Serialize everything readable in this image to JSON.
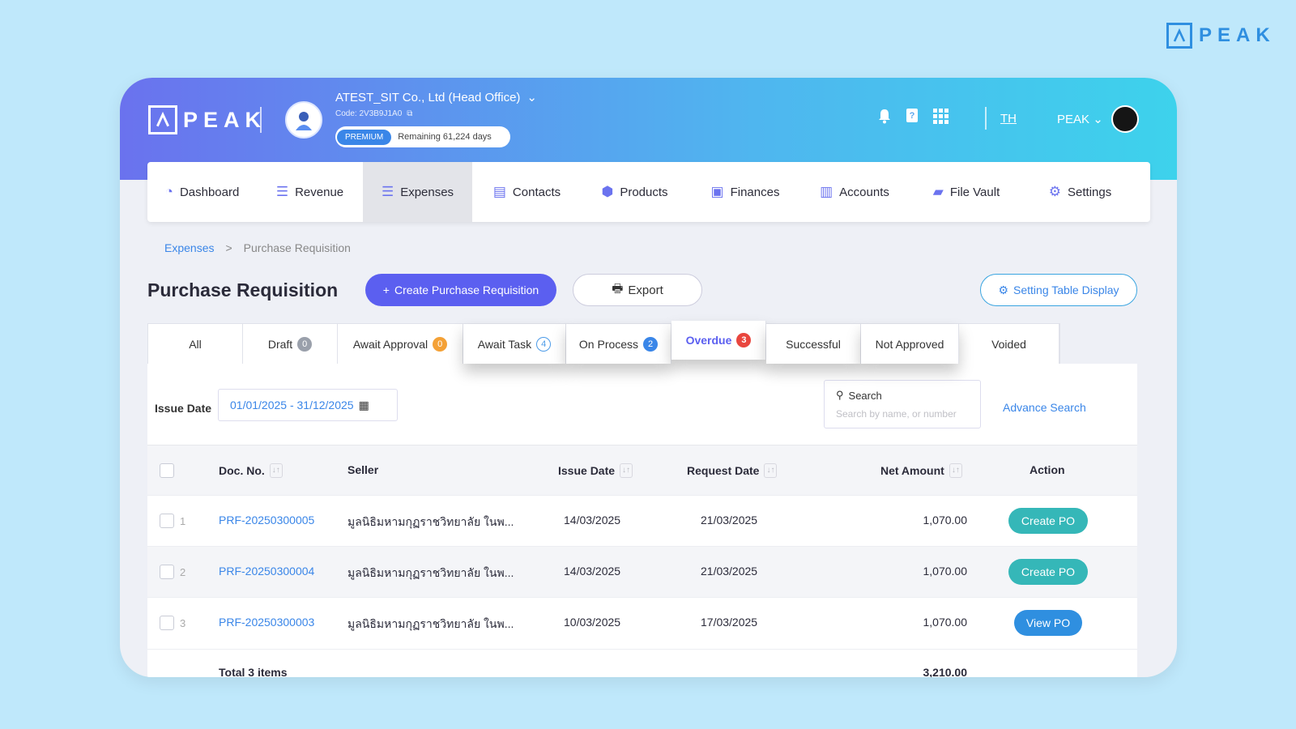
{
  "brand": {
    "logo_text": "PEAK"
  },
  "header": {
    "company_name": "ATEST_SIT Co., Ltd (Head Office)",
    "company_code": "Code: 2V3B9J1A0",
    "plan_badge": "PREMIUM",
    "plan_remaining": "Remaining 61,224 days",
    "language": "TH",
    "user_name": "PEAK",
    "icons": [
      "bell-icon",
      "help-book-icon",
      "apps-grid-icon"
    ]
  },
  "nav": {
    "items": [
      {
        "label": "Dashboard",
        "icon": "dashboard-icon"
      },
      {
        "label": "Revenue",
        "icon": "list-icon"
      },
      {
        "label": "Expenses",
        "icon": "list-icon",
        "active": true
      },
      {
        "label": "Contacts",
        "icon": "contacts-icon"
      },
      {
        "label": "Products",
        "icon": "box-icon"
      },
      {
        "label": "Finances",
        "icon": "money-icon"
      },
      {
        "label": "Accounts",
        "icon": "ledger-icon"
      },
      {
        "label": "File Vault",
        "icon": "folder-icon"
      },
      {
        "label": "Settings",
        "icon": "gear-icon"
      }
    ]
  },
  "breadcrumb": {
    "parent": "Expenses",
    "separator": ">",
    "current": "Purchase Requisition"
  },
  "page": {
    "title": "Purchase Requisition",
    "create_button": "Create Purchase Requisition",
    "export_button": "Export",
    "setting_button": "Setting Table Display"
  },
  "status_tabs": [
    {
      "label": "All",
      "count": null
    },
    {
      "label": "Draft",
      "count": "0"
    },
    {
      "label": "Await Approval",
      "count": "0"
    },
    {
      "label": "Await Task",
      "count": "4"
    },
    {
      "label": "On Process",
      "count": "2"
    },
    {
      "label": "Overdue",
      "count": "3"
    },
    {
      "label": "Successful",
      "count": null
    },
    {
      "label": "Not Approved",
      "count": null
    },
    {
      "label": "Voided",
      "count": null
    }
  ],
  "filter": {
    "issue_date_label": "Issue Date",
    "issue_date_value": "01/01/2025 - 31/12/2025",
    "search_label": "Search",
    "search_placeholder": "Search by name, or number",
    "advance_search": "Advance Search"
  },
  "table": {
    "columns": {
      "doc_no": "Doc. No.",
      "seller": "Seller",
      "issue_date": "Issue Date",
      "request_date": "Request Date",
      "net_amount": "Net Amount",
      "action": "Action"
    },
    "rows": [
      {
        "num": "1",
        "doc_no": "PRF-20250300005",
        "seller": "มูลนิธิมหามกุฏราชวิทยาลัย ในพ...",
        "issue_date": "14/03/2025",
        "request_date": "21/03/2025",
        "net_amount": "1,070.00",
        "action": "Create PO"
      },
      {
        "num": "2",
        "doc_no": "PRF-20250300004",
        "seller": "มูลนิธิมหามกุฏราชวิทยาลัย ในพ...",
        "issue_date": "14/03/2025",
        "request_date": "21/03/2025",
        "net_amount": "1,070.00",
        "action": "Create PO"
      },
      {
        "num": "3",
        "doc_no": "PRF-20250300003",
        "seller": "มูลนิธิมหามกุฏราชวิทยาลัย ในพ...",
        "issue_date": "10/03/2025",
        "request_date": "17/03/2025",
        "net_amount": "1,070.00",
        "action": "View PO"
      }
    ],
    "total_label": "Total 3 items",
    "total_amount": "3,210.00"
  },
  "colors": {
    "primary": "#5b5ff0",
    "link": "#3a86e8",
    "teal": "#35b7b8",
    "overdue": "#e9463e"
  }
}
